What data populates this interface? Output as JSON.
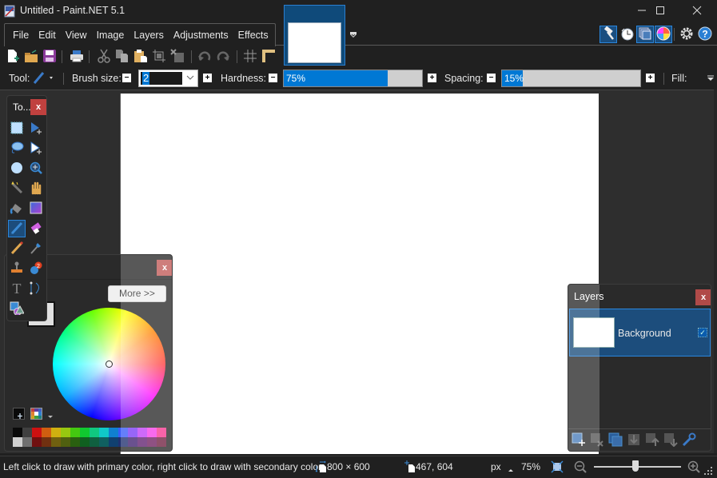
{
  "window": {
    "title": "Untitled - Paint.NET 5.1",
    "minimize_icon": "minimize-icon",
    "maximize_icon": "maximize-icon",
    "close_icon": "close-icon"
  },
  "menu": {
    "items": [
      "File",
      "Edit",
      "View",
      "Image",
      "Layers",
      "Adjustments",
      "Effects"
    ]
  },
  "top_right_icons": [
    {
      "name": "tools-window-toggle",
      "icon": "hammer-icon",
      "active": true
    },
    {
      "name": "history-window-toggle",
      "icon": "history-clock-icon",
      "active": false
    },
    {
      "name": "layers-window-toggle",
      "icon": "layers-icon",
      "active": true
    },
    {
      "name": "colors-window-toggle",
      "icon": "color-wheel-icon",
      "active": true
    },
    {
      "name": "settings-button",
      "icon": "gear-icon",
      "active": false
    },
    {
      "name": "help-button",
      "icon": "help-icon",
      "active": false
    }
  ],
  "toolbar": {
    "buttons": [
      "new",
      "open",
      "save",
      "print",
      "cut",
      "copy",
      "paste",
      "crop-to-selection",
      "deselect",
      "undo",
      "redo",
      "grid",
      "rulers"
    ]
  },
  "options": {
    "tool_label": "Tool:",
    "brush_size_label": "Brush size:",
    "brush_size_value": "2",
    "hardness_label": "Hardness:",
    "hardness_value": "75%",
    "hardness_percent": 75,
    "spacing_label": "Spacing:",
    "spacing_value": "15%",
    "spacing_percent": 15,
    "fill_label": "Fill:",
    "minus": "−",
    "plus": "+"
  },
  "tools_window": {
    "title": "To...",
    "close": "x",
    "tools": [
      "rectangle-select",
      "move-selected-pixels",
      "lasso-select",
      "move-selection",
      "ellipse-select",
      "zoom",
      "magic-wand",
      "pan",
      "paint-bucket",
      "gradient",
      "paintbrush",
      "eraser",
      "pencil",
      "color-picker",
      "clone-stamp",
      "recolor",
      "text",
      "line-curve",
      "shapes"
    ],
    "active_tool": "paintbrush"
  },
  "colors_window": {
    "close": "x",
    "more_button": "More >>",
    "primary_color": "#000000",
    "secondary_color": "#ffffff",
    "palette_top": [
      "#0a0a0a",
      "#404040",
      "#cc1111",
      "#d05e10",
      "#d0b010",
      "#98c810",
      "#44c810",
      "#10c830",
      "#10c880",
      "#10c8c8",
      "#1080d0",
      "#3a5cf8",
      "#7a3cf8",
      "#c040f8",
      "#f840e8",
      "#f83890"
    ],
    "palette_bottom": [
      "#d0d0d0",
      "#707070",
      "#701010",
      "#703010",
      "#706010",
      "#506010",
      "#2a6010",
      "#106020",
      "#106040",
      "#106060",
      "#104070",
      "#203070",
      "#402070",
      "#602070",
      "#702060",
      "#702040"
    ]
  },
  "layers_window": {
    "title": "Layers",
    "close": "x",
    "layers": [
      {
        "name": "Background",
        "visible": true,
        "selected": true
      }
    ],
    "buttons": [
      "add-layer",
      "delete-layer",
      "duplicate-layer",
      "merge-layer-down",
      "move-layer-up",
      "move-layer-down",
      "layer-properties"
    ]
  },
  "status": {
    "hint": "Left click to draw with primary color, right click to draw with secondary color.",
    "image_size": "800 × 600",
    "cursor_pos": "467, 604",
    "units": "px",
    "zoom": "75%",
    "zoom_slider_fraction": 0.48
  }
}
